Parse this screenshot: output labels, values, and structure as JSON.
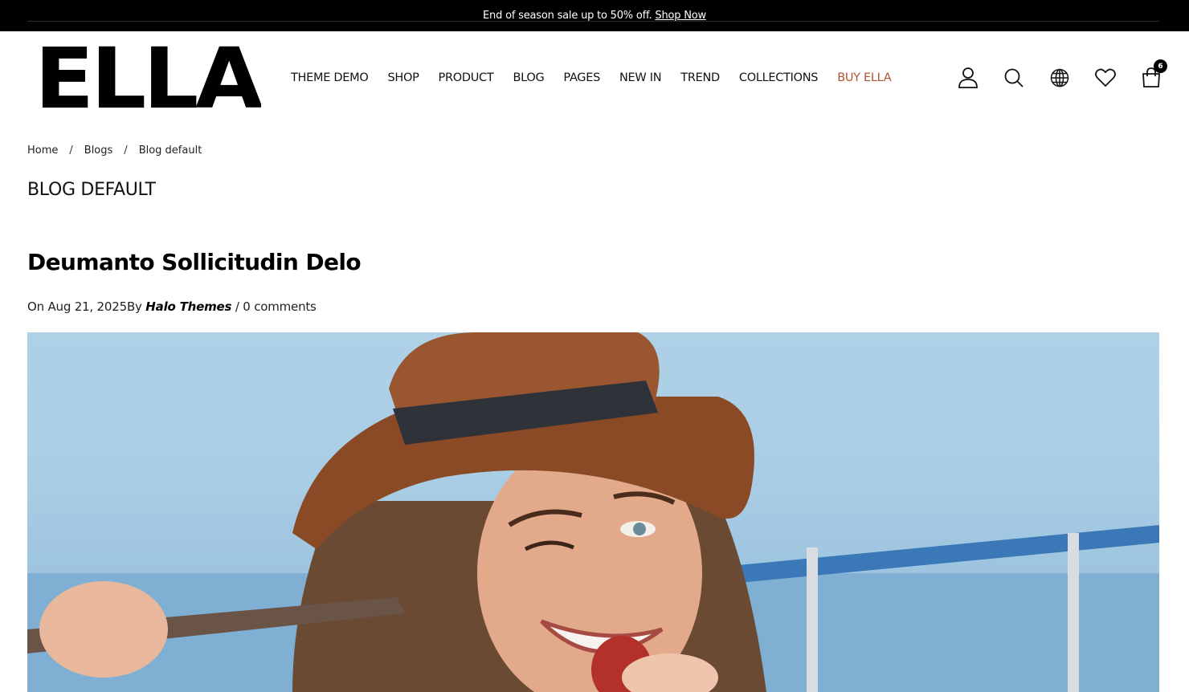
{
  "announcement": {
    "text": "End of season sale up to 50% off.",
    "link_label": "Shop Now"
  },
  "brand": {
    "logo_text": "ELLA"
  },
  "nav": {
    "items": [
      {
        "label": "THEME DEMO"
      },
      {
        "label": "SHOP"
      },
      {
        "label": "PRODUCT"
      },
      {
        "label": "BLOG"
      },
      {
        "label": "PAGES"
      },
      {
        "label": "NEW IN"
      },
      {
        "label": "TREND"
      },
      {
        "label": "COLLECTIONS"
      },
      {
        "label": "BUY ELLA"
      }
    ],
    "accent_color": "#b0522f"
  },
  "header_icons": {
    "account": "user-icon",
    "search": "search-icon",
    "language": "globe-icon",
    "wishlist": "heart-icon",
    "cart": "shopping-bag-icon",
    "cart_count": "6"
  },
  "breadcrumb": {
    "items": [
      "Home",
      "Blogs",
      "Blog default"
    ],
    "separator": "/"
  },
  "page": {
    "title": "BLOG DEFAULT"
  },
  "post": {
    "title": "Deumanto Sollicitudin Delo",
    "date_prefix": "On Aug 21, 2025",
    "by_label": "By",
    "author": "Halo Themes",
    "comments_sep": "/",
    "comments": "0 comments"
  }
}
